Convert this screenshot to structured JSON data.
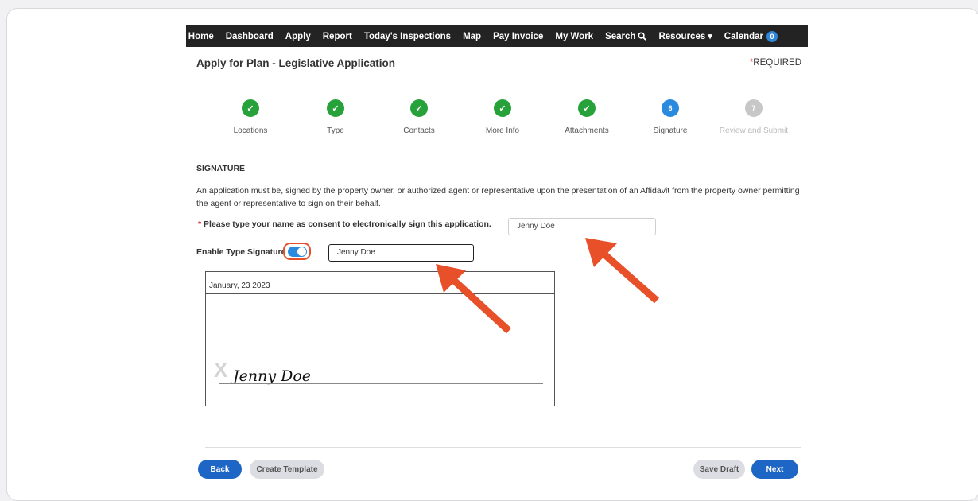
{
  "nav": {
    "items": [
      "Home",
      "Dashboard",
      "Apply",
      "Report",
      "Today's Inspections",
      "Map",
      "Pay Invoice",
      "My Work"
    ],
    "search_label": "Search",
    "resources_label": "Resources",
    "calendar_label": "Calendar",
    "calendar_count": "0"
  },
  "header": {
    "title": "Apply for Plan - Legislative Application",
    "required_star": "*",
    "required_text": "REQUIRED"
  },
  "stepper": {
    "steps": [
      {
        "label": "Locations",
        "state": "done",
        "marker": "✓"
      },
      {
        "label": "Type",
        "state": "done",
        "marker": "✓"
      },
      {
        "label": "Contacts",
        "state": "done",
        "marker": "✓"
      },
      {
        "label": "More Info",
        "state": "done",
        "marker": "✓"
      },
      {
        "label": "Attachments",
        "state": "done",
        "marker": "✓"
      },
      {
        "label": "Signature",
        "state": "active",
        "marker": "6"
      },
      {
        "label": "Review and Submit",
        "state": "pending",
        "marker": "7"
      }
    ]
  },
  "signature": {
    "section_title": "SIGNATURE",
    "description": "An application must be, signed by the property owner, or authorized agent or representative upon the presentation of an Affidavit from the property owner permitting the agent or representative to sign on their behalf.",
    "consent_star": "*",
    "consent_label": "Please type your name as consent to electronically sign this application.",
    "consent_value": "Jenny Doe",
    "enable_label": "Enable Type Signature",
    "toggle_on": true,
    "typed_value": "Jenny Doe",
    "pad_date": "January, 23 2023",
    "pad_x": "X",
    "pad_name": "Jenny Doe"
  },
  "footer": {
    "back": "Back",
    "create_template": "Create Template",
    "save_draft": "Save Draft",
    "next": "Next"
  },
  "colors": {
    "nav_bg": "#232323",
    "step_done": "#27a13a",
    "step_active": "#2a8ae0",
    "arrow": "#e8502a",
    "primary_button": "#1d66c6"
  }
}
